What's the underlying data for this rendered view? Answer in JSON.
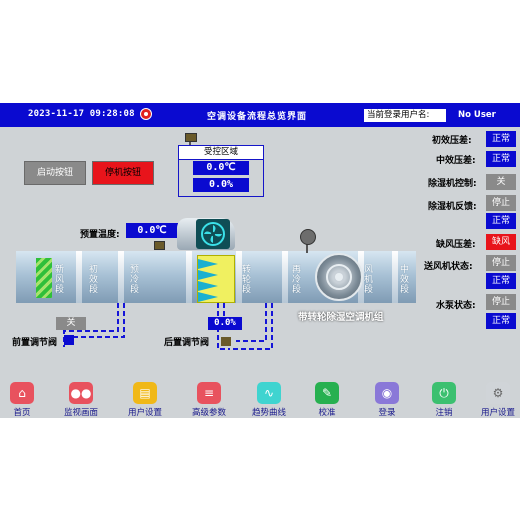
{
  "header": {
    "datetime": "2023-11-17  09:28:08",
    "title": "空调设备流程总览界面",
    "user_label": "当前登录用户名:",
    "user_name": "No User"
  },
  "buttons": {
    "start": "启动按钮",
    "stop": "停机按钮"
  },
  "control_area": {
    "title": "受控区域",
    "temperature": "0.0℃",
    "humidity": "0.0%"
  },
  "preheat": {
    "label": "预置温度:",
    "value": "0.0℃"
  },
  "sections": [
    "新风段",
    "初效段",
    "预冷段",
    "转轮段",
    "再冷段",
    "风机段",
    "中效段"
  ],
  "unit_title": "带转轮除湿空调机组",
  "valves": {
    "front": {
      "label": "前置调节阀",
      "value": "关"
    },
    "rear": {
      "label": "后置调节阀",
      "value": "0.0%"
    }
  },
  "status": [
    {
      "label": "初效压差:",
      "value": "正常",
      "color": "#0a0ad0"
    },
    {
      "label": "中效压差:",
      "value": "正常",
      "color": "#0a0ad0"
    },
    {
      "label": "除湿机控制:",
      "value": "关",
      "color": "#8a8a8a"
    },
    {
      "label": "除湿机反馈:",
      "value": "停止",
      "color": "#8a8a8a",
      "value2": "正常"
    },
    {
      "label": "缺风压差:",
      "value": "缺风",
      "color": "#e8141b"
    },
    {
      "label": "送风机状态:",
      "value": "停止",
      "color": "#8a8a8a",
      "value2": "正常"
    },
    {
      "label": "水泵状态:",
      "value": "停止",
      "color": "#8a8a8a",
      "value2": "正常"
    }
  ],
  "nav": [
    {
      "label": "首页",
      "icon": "home-icon",
      "color": "#e8525e"
    },
    {
      "label": "监视画面",
      "icon": "monitor-icon",
      "color": "#e8525e"
    },
    {
      "label": "用户设置",
      "icon": "user-settings-icon",
      "color": "#f0b818"
    },
    {
      "label": "高级参数",
      "icon": "parameters-icon",
      "color": "#e8525e"
    },
    {
      "label": "趋势曲线",
      "icon": "trend-icon",
      "color": "#3fd4d0"
    },
    {
      "label": "校准",
      "icon": "calibrate-icon",
      "color": "#27b050"
    },
    {
      "label": "登录",
      "icon": "login-icon",
      "color": "#8a78d8"
    },
    {
      "label": "注销",
      "icon": "logout-icon",
      "color": "#3cc070"
    },
    {
      "label": "用户设置",
      "icon": "user-gear-icon",
      "color": "#d0d4d8"
    }
  ]
}
